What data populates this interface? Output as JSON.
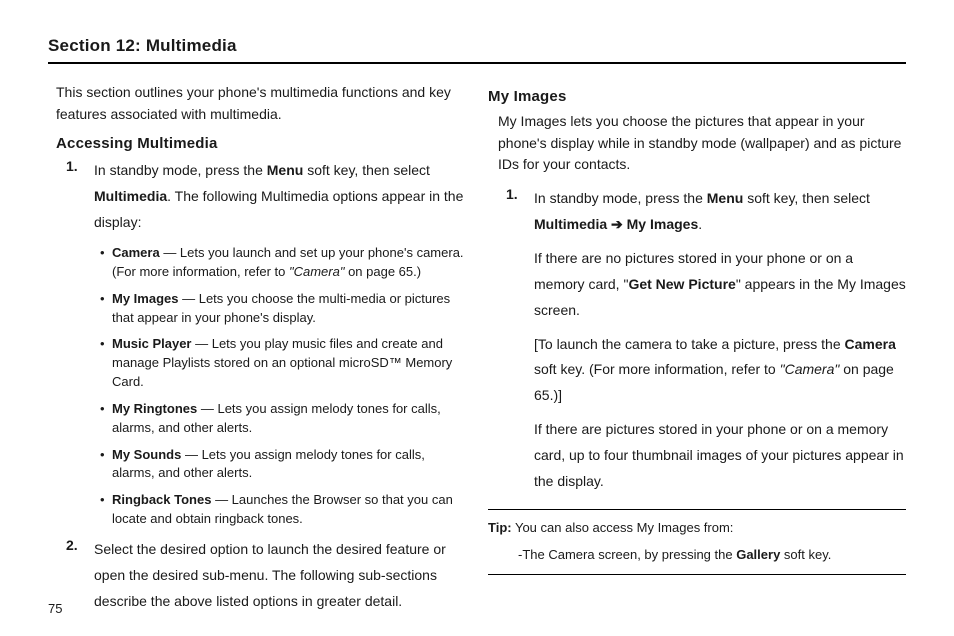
{
  "section_title": "Section 12: Multimedia",
  "left": {
    "intro": "This section outlines your phone's multimedia functions and key features associated with multimedia.",
    "heading": "Accessing Multimedia",
    "step1": {
      "num": "1.",
      "pre": "In standby mode, press the ",
      "menu": "Menu",
      "mid": " soft key, then select ",
      "multimedia": "Multimedia",
      "post": ". The following Multimedia options appear in the display:"
    },
    "bullets": [
      {
        "label": "Camera",
        "dash": " — Lets you launch and set up your phone's camera. (For more information, refer to ",
        "ital": "\"Camera\"",
        "tail": "  on page 65.)"
      },
      {
        "label": "My Images",
        "dash": " — Lets you choose the multi-media or pictures that appear in your phone's display.",
        "ital": "",
        "tail": ""
      },
      {
        "label": "Music Player",
        "dash": " — Lets you play music files and create and manage Playlists stored on an optional microSD™ Memory Card.",
        "ital": "",
        "tail": ""
      },
      {
        "label": "My Ringtones",
        "dash": " — Lets you assign melody tones for calls, alarms, and other alerts.",
        "ital": "",
        "tail": ""
      },
      {
        "label": "My Sounds",
        "dash": " — Lets you assign melody tones for calls, alarms, and other alerts.",
        "ital": "",
        "tail": ""
      },
      {
        "label": "Ringback Tones",
        "dash": " — Launches the Browser so that you can locate and obtain ringback tones.",
        "ital": "",
        "tail": ""
      }
    ],
    "step2": {
      "num": "2.",
      "text": "Select the desired option to launch the desired feature or open the desired sub-menu. The following sub-sections describe the above listed options in greater detail."
    }
  },
  "right": {
    "heading": "My Images",
    "intro": "My Images lets you choose the pictures that appear in your phone's display while in standby mode (wallpaper) and as picture IDs for your contacts.",
    "step1": {
      "num": "1.",
      "pre": "In standby mode, press the ",
      "menu": "Menu",
      "mid": " soft key, then select ",
      "path1": "Multimedia",
      "arrow": " ➔ ",
      "path2": "My Images",
      "dot": ".",
      "p2a": "If there are no pictures stored in your phone or on a memory card, \"",
      "p2b": "Get New Picture",
      "p2c": "\" appears in the My Images screen.",
      "p3a": "[To launch the camera to take a picture, press the ",
      "p3b": "Camera",
      "p3c": " soft key. (For more information, refer to ",
      "p3ital": "\"Camera\"",
      "p3d": "  on page 65.)]",
      "p4": "If there are pictures stored in your phone or on a memory card, up to four thumbnail images of your pictures appear in the display."
    },
    "tip_label": "Tip:",
    "tip_text": " You can also access My Images from:",
    "tip_sub_pre": "-The Camera screen, by pressing the ",
    "tip_sub_b": "Gallery",
    "tip_sub_post": " soft key."
  },
  "page_number": "75"
}
